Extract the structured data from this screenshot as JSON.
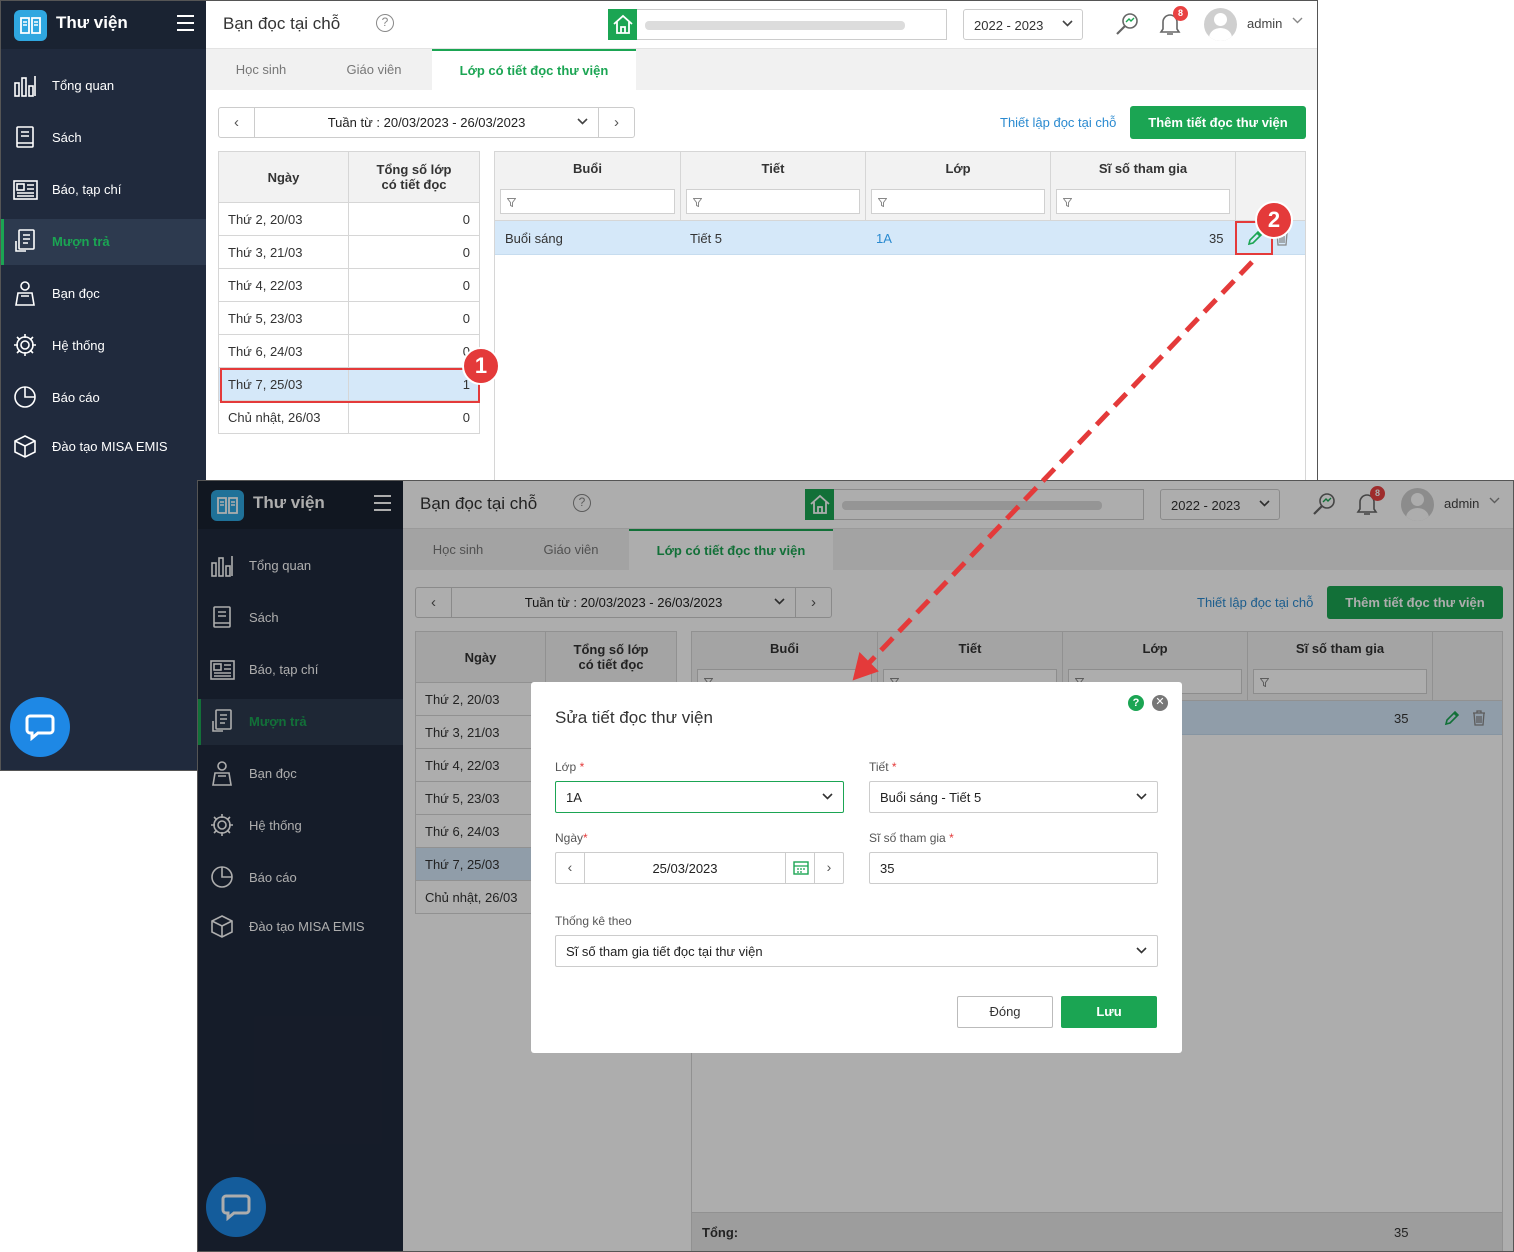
{
  "app": {
    "brand": "Thư viện",
    "page_title": "Bạn đọc tại chỗ",
    "school_year": "2022 - 2023",
    "notification_count": "8",
    "user": "admin"
  },
  "nav": [
    {
      "label": "Tổng quan",
      "icon": "chart-icon"
    },
    {
      "label": "Sách",
      "icon": "book-icon"
    },
    {
      "label": "Báo, tạp chí",
      "icon": "newspaper-icon"
    },
    {
      "label": "Mượn trả",
      "icon": "borrow-icon",
      "active": true
    },
    {
      "label": "Bạn đọc",
      "icon": "reader-icon"
    },
    {
      "label": "Hệ thống",
      "icon": "gear-icon"
    },
    {
      "label": "Báo cáo",
      "icon": "pie-icon"
    },
    {
      "label": "Đào tạo MISA EMIS",
      "icon": "cube-icon"
    }
  ],
  "tabs": [
    "Học sinh",
    "Giáo viên",
    "Lớp có tiết đọc thư viện"
  ],
  "week_label": "Tuần từ : 20/03/2023 - 26/03/2023",
  "setup_link": "Thiết lập đọc tại chỗ",
  "add_button": "Thêm tiết đọc thư viện",
  "day_table": {
    "headers": [
      "Ngày",
      "Tổng số lớp\ncó tiết đọc"
    ],
    "rows": [
      {
        "day": "Thứ 2, 20/03",
        "count": "0"
      },
      {
        "day": "Thứ 3, 21/03",
        "count": "0"
      },
      {
        "day": "Thứ 4, 22/03",
        "count": "0"
      },
      {
        "day": "Thứ 5, 23/03",
        "count": "0"
      },
      {
        "day": "Thứ 6, 24/03",
        "count": "0"
      },
      {
        "day": "Thứ 7, 25/03",
        "count": "1"
      },
      {
        "day": "Chủ nhật, 26/03",
        "count": "0"
      }
    ],
    "selected_index": 5
  },
  "lesson_table": {
    "headers": [
      "Buổi",
      "Tiết",
      "Lớp",
      "Sĩ số tham gia"
    ],
    "row": {
      "session": "Buổi sáng",
      "period": "Tiết 5",
      "class": "1A",
      "attendance": "35"
    },
    "total_label": "Tổng:",
    "total_value": "35"
  },
  "callouts": [
    "1",
    "2"
  ],
  "modal": {
    "title": "Sửa tiết đọc thư viện",
    "class_label": "Lớp",
    "class_value": "1A",
    "period_label": "Tiết",
    "period_value": "Buổi sáng - Tiết 5",
    "date_label": "Ngày",
    "date_value": "25/03/2023",
    "attendance_label": "Sĩ số tham gia",
    "attendance_value": "35",
    "stat_label": "Thống kê theo",
    "stat_value": "Sĩ số tham gia tiết đọc tại thư viện",
    "close_button": "Đóng",
    "save_button": "Lưu"
  },
  "colors": {
    "sidebar": "#202a3d",
    "accent": "#1ba553",
    "selection": "#d5e8f9",
    "callout": "#e43a3a",
    "link": "#2a8ad0"
  }
}
